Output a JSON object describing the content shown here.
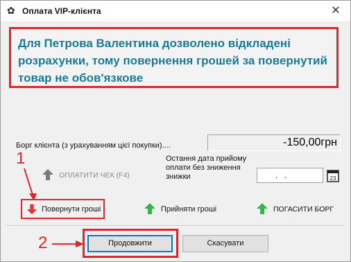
{
  "window": {
    "title": "Оплата VIP-клієнта",
    "title_icon": "gear-icon",
    "close_label": "✕"
  },
  "banner": {
    "text": "Для Петрова Валентина дозволено відкладені розрахунки, тому повернення грошей за повернутий товар не обов'язкове",
    "border_color": "#e0242a",
    "text_color": "#1a7a95"
  },
  "debt": {
    "label": "Борг клієнта (з урахуванням цієї покупки)....",
    "value": "-150,00грн"
  },
  "pay_check": {
    "label": "ОПЛАТИТИ ЧЕК (F4)",
    "icon": "arrow-up-gray-icon"
  },
  "last_date": {
    "label": "Остання дата прийому оплати без зниження знижки",
    "value": ". .",
    "calendar_icon": "calendar-icon"
  },
  "actions": {
    "return_label": "Повернути гроші",
    "return_icon": "arrow-down-red-icon",
    "accept_label": "Прийняти гроші",
    "accept_icon": "arrow-up-green-icon",
    "repay_label": "ПОГАСИТИ БОРГ",
    "repay_icon": "arrow-up-green-icon"
  },
  "footer": {
    "continue_label": "Продовжити",
    "cancel_label": "Скасувати"
  },
  "annotations": {
    "step1": "1",
    "step2": "2",
    "color": "#e0242a"
  }
}
